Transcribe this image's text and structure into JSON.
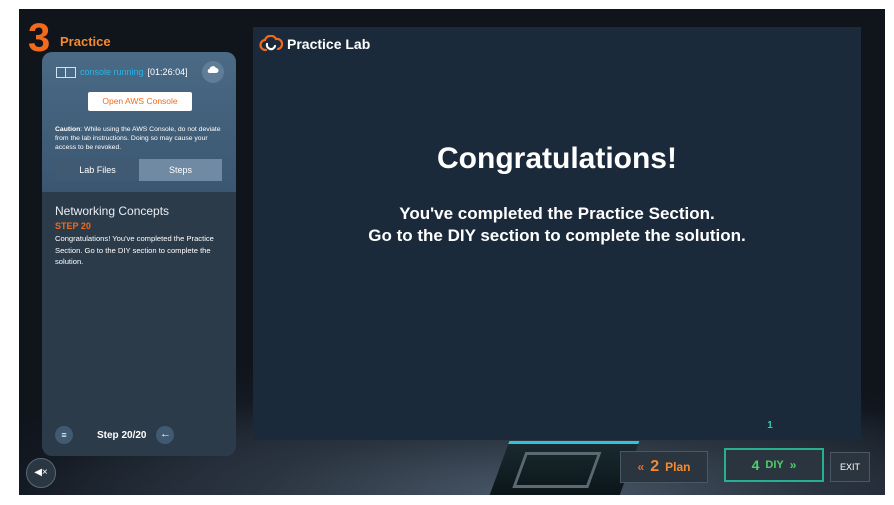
{
  "section": {
    "number": "3",
    "title": "Practice"
  },
  "console": {
    "status": "console running",
    "timer": "[01:26:04]",
    "open_button": "Open AWS Console"
  },
  "caution": {
    "label": "Caution",
    "text": ": While using the AWS Console, do not deviate from the lab instructions. Doing so may cause your access to be revoked."
  },
  "tabs": [
    {
      "label": "Lab Files"
    },
    {
      "label": "Steps"
    }
  ],
  "step": {
    "module": "Networking Concepts",
    "label": "STEP 20",
    "text": "Congratulations! You've completed the Practice Section. Go to the DIY section to complete the solution.",
    "counter": "Step 20/20"
  },
  "main": {
    "brand": "Practice Lab",
    "heading": "Congratulations!",
    "line1": "You've completed the Practice Section.",
    "line2": "Go to the DIY section to complete the solution.",
    "marker": "1"
  },
  "nav": {
    "prev": {
      "number": "2",
      "label": "Plan",
      "chevron": "«"
    },
    "next": {
      "number": "4",
      "label": "DIY",
      "chevron": "»"
    },
    "exit": "EXIT"
  },
  "icons": {
    "mute": "mute-icon",
    "cloud": "cloud-icon",
    "list": "list-icon",
    "back": "back-arrow-icon"
  },
  "colors": {
    "accent_orange": "#f26a1b",
    "accent_green": "#4fd06a",
    "accent_teal": "#26b08e",
    "link_blue": "#2ab4e6"
  }
}
